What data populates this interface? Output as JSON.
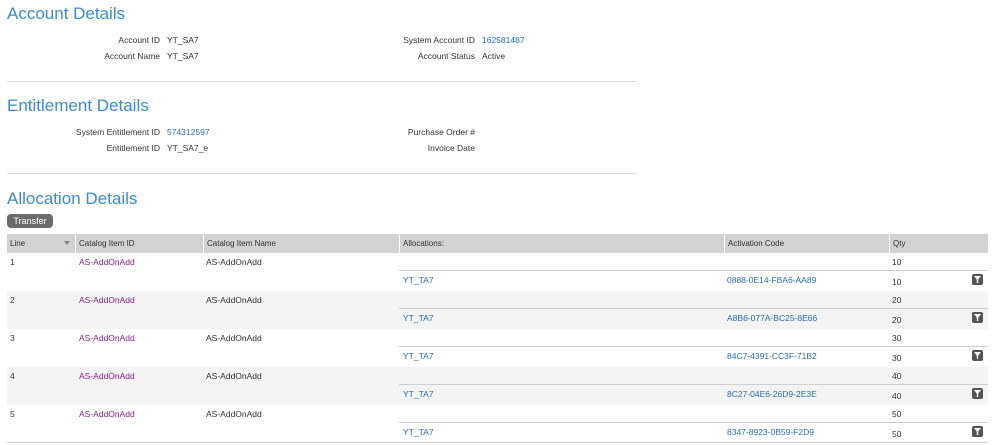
{
  "account": {
    "title": "Account Details",
    "account_id_label": "Account ID",
    "account_id": "YT_SA7",
    "account_name_label": "Account Name",
    "account_name": "YT_SA7",
    "system_account_id_label": "System Account ID",
    "system_account_id": "162581487",
    "account_status_label": "Account Status",
    "account_status": "Active"
  },
  "entitlement": {
    "title": "Entitlement Details",
    "system_entitlement_id_label": "System Entitlement ID",
    "system_entitlement_id": "574312597",
    "entitlement_id_label": "Entitlement ID",
    "entitlement_id": "YT_SA7_e",
    "purchase_order_label": "Purchase Order #",
    "invoice_date_label": "Invoice Date"
  },
  "allocation": {
    "title": "Allocation Details",
    "transfer_label": "Transfer",
    "columns": {
      "line": "Line",
      "catalog_item_id": "Catalog Item ID",
      "catalog_item_name": "Catalog Item Name",
      "allocations": "Allocations:",
      "activation_code": "Activation Code",
      "qty": "Qty"
    },
    "rows": [
      {
        "line": "1",
        "item_id": "AS-AddOnAdd",
        "item_name": "AS-AddOnAdd",
        "qty": "10",
        "alloc": {
          "name": "YT_TA7",
          "code": "0888-0E14-FBA6-AA89",
          "qty": "10"
        }
      },
      {
        "line": "2",
        "item_id": "AS-AddOnAdd",
        "item_name": "AS-AddOnAdd",
        "qty": "20",
        "alloc": {
          "name": "YT_TA7",
          "code": "A8B6-077A-BC25-8E66",
          "qty": "20"
        }
      },
      {
        "line": "3",
        "item_id": "AS-AddOnAdd",
        "item_name": "AS-AddOnAdd",
        "qty": "30",
        "alloc": {
          "name": "YT_TA7",
          "code": "84C7-4391-CC3F-71B2",
          "qty": "30"
        }
      },
      {
        "line": "4",
        "item_id": "AS-AddOnAdd",
        "item_name": "AS-AddOnAdd",
        "qty": "40",
        "alloc": {
          "name": "YT_TA7",
          "code": "8C27-04E6-26D9-2E3E",
          "qty": "40"
        }
      },
      {
        "line": "5",
        "item_id": "AS-AddOnAdd",
        "item_name": "AS-AddOnAdd",
        "qty": "50",
        "alloc": {
          "name": "YT_TA7",
          "code": "8347-8923-0B59-F2D9",
          "qty": "50"
        }
      }
    ]
  },
  "colors": {
    "title_blue": "#3b8dc9",
    "link_blue": "#2a6bb0",
    "item_purple": "#8a1f8a",
    "header_gray": "#d2d2d2",
    "button_gray": "#6b6b6b"
  },
  "icons": {
    "filter": "filter-icon",
    "sort": "sort-icon"
  }
}
